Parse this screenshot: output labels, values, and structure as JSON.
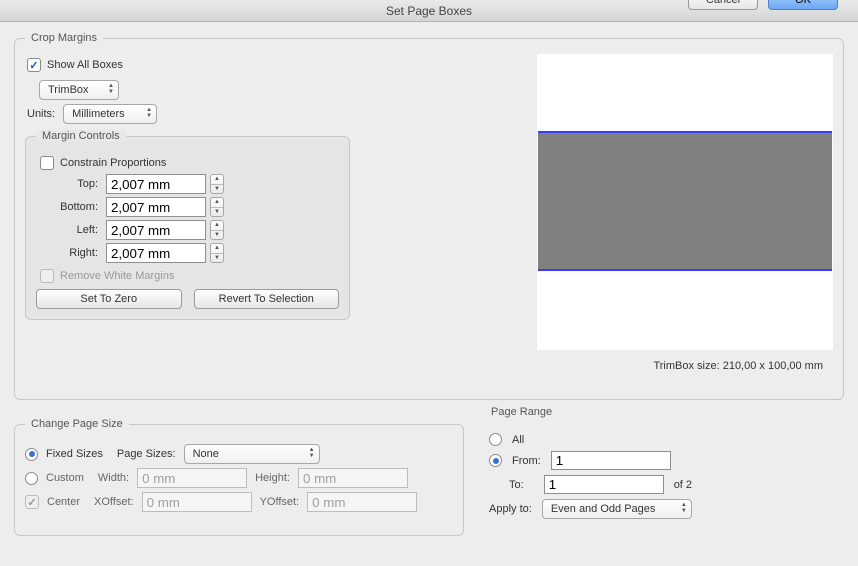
{
  "title": "Set Page Boxes",
  "crop": {
    "legend": "Crop Margins",
    "show_all": "Show All Boxes",
    "box_select": "TrimBox",
    "units_label": "Units:",
    "units_value": "Millimeters",
    "margin": {
      "legend": "Margin Controls",
      "constrain": "Constrain Proportions",
      "top_label": "Top:",
      "top_value": "2,007 mm",
      "bottom_label": "Bottom:",
      "bottom_value": "2,007 mm",
      "left_label": "Left:",
      "left_value": "2,007 mm",
      "right_label": "Right:",
      "right_value": "2,007 mm",
      "remove_white": "Remove White Margins",
      "set_zero": "Set To Zero",
      "revert": "Revert To Selection"
    },
    "preview_label": "TrimBox size: 210,00 x 100,00 mm"
  },
  "change": {
    "legend": "Change Page Size",
    "fixed": "Fixed Sizes",
    "page_sizes_label": "Page Sizes:",
    "page_sizes_value": "None",
    "custom": "Custom",
    "width_label": "Width:",
    "width_value": "0 mm",
    "height_label": "Height:",
    "height_value": "0 mm",
    "center": "Center",
    "xoff_label": "XOffset:",
    "xoff_value": "0 mm",
    "yoff_label": "YOffset:",
    "yoff_value": "0 mm"
  },
  "range": {
    "legend": "Page Range",
    "all": "All",
    "from_label": "From:",
    "from_value": "1",
    "to_label": "To:",
    "to_value": "1",
    "of_label": "of 2",
    "apply_label": "Apply to:",
    "apply_value": "Even and Odd Pages"
  },
  "footer": {
    "cancel": "Cancel",
    "ok": "OK"
  }
}
